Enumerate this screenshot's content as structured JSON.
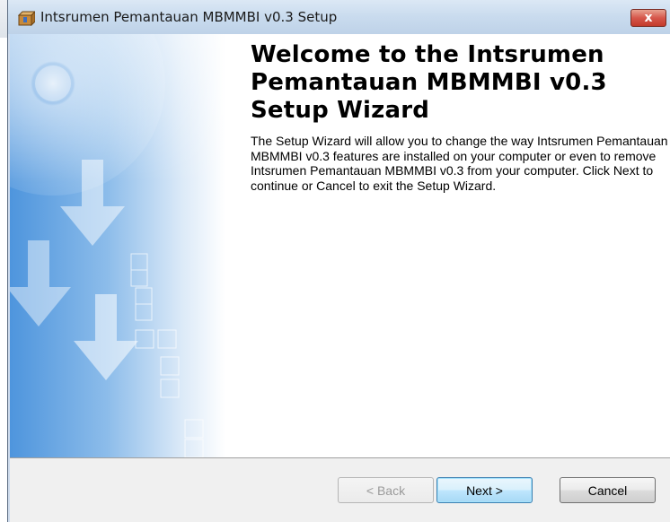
{
  "window": {
    "title": "Intsrumen Pemantauan MBMMBI v0.3 Setup",
    "close_symbol": "x",
    "app_icon": "setup-package-icon"
  },
  "banner": {
    "description_icons": [
      "cd-disc-icon",
      "down-arrow-icon"
    ],
    "accent_color": "#3a86d8"
  },
  "welcome": {
    "title": "Welcome to the Intsrumen Pemantauan MBMMBI v0.3 Setup Wizard",
    "body": "The Setup Wizard will allow you to change the way Intsrumen Pemantauan MBMMBI v0.3 features are installed on your computer or even to remove Intsrumen Pemantauan MBMMBI v0.3 from your computer.  Click Next to continue or Cancel to exit the Setup Wizard."
  },
  "buttons": {
    "back": "< Back",
    "next": "Next >",
    "cancel": "Cancel"
  }
}
